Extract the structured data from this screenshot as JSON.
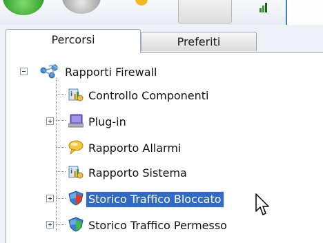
{
  "tabs": [
    {
      "label": "Percorsi",
      "active": true
    },
    {
      "label": "Preferiti",
      "active": false
    }
  ],
  "tree": {
    "root": {
      "label": "Rapporti Firewall",
      "icon": "network-icon",
      "expanded": true
    },
    "items": [
      {
        "label": "Controllo Componenti",
        "icon": "report-icon",
        "expander": null,
        "selected": false
      },
      {
        "label": "Plug-in",
        "icon": "monitor-icon",
        "expander": "plus",
        "selected": false
      },
      {
        "label": "Rapporto Allarmi",
        "icon": "speech-bubble-icon",
        "expander": null,
        "selected": false
      },
      {
        "label": "Rapporto Sistema",
        "icon": "report-icon",
        "expander": null,
        "selected": false
      },
      {
        "label": "Storico Traffico Bloccato",
        "icon": "shield-red-icon",
        "expander": "plus",
        "selected": true
      },
      {
        "label": "Storico Traffico Permesso",
        "icon": "shield-green-icon",
        "expander": "plus",
        "selected": false
      }
    ]
  },
  "colors": {
    "selection": "#316ac5",
    "tree_lines": "#8a8a8a",
    "panel_bg": "#eef2f6"
  }
}
